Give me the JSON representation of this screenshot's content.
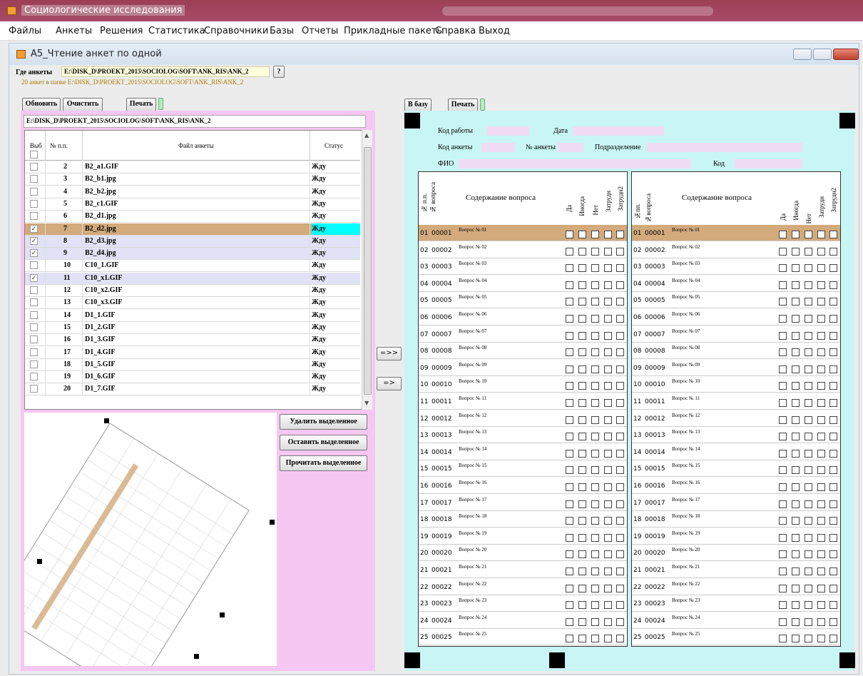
{
  "app_title": "Социологические исследования",
  "menu": [
    "Файлы",
    "Анкеты",
    "Решения",
    "Статистика",
    "Справочники",
    "Базы",
    "Отчеты",
    "Прикладные пакеты",
    "Справка",
    "Выход"
  ],
  "window_title": "А5_Чтение анкет по одной",
  "where_label": "Где анкеты",
  "where_value": "E:\\DISK_D\\PROEKT_2015\\SOCIOLOG\\SOFT\\ANK_RIS\\ANK_2",
  "browse_label": "?",
  "folder_status": "20 анкет в папке E:\\DISK_D\\PROEKT_2015\\SOCIOLOG\\SOFT\\ANK_RIS\\ANK_2",
  "btn_refresh": "Обновить",
  "btn_clear": "Очистить",
  "btn_print_left": "Печать",
  "btn_to_db": "В базу",
  "btn_print_right": "Печать",
  "path_display": "E:\\DISK_D\\PROEKT_2015\\SOCIOLOG\\SOFT\\ANK_RIS\\ANK_2",
  "grid": {
    "col_select": "Выб",
    "col_num": "№ п.п.",
    "col_file": "Файл анкеты",
    "col_status": "Статус",
    "rows": [
      {
        "n": "2",
        "f": "B2_a1.GIF",
        "s": "Жду",
        "chk": false,
        "sel": false,
        "cur": false
      },
      {
        "n": "3",
        "f": "B2_b1.jpg",
        "s": "Жду",
        "chk": false,
        "sel": false,
        "cur": false
      },
      {
        "n": "4",
        "f": "B2_b2.jpg",
        "s": "Жду",
        "chk": false,
        "sel": false,
        "cur": false
      },
      {
        "n": "5",
        "f": "B2_c1.GIF",
        "s": "Жду",
        "chk": false,
        "sel": false,
        "cur": false
      },
      {
        "n": "6",
        "f": "B2_d1.jpg",
        "s": "Жду",
        "chk": false,
        "sel": false,
        "cur": false
      },
      {
        "n": "7",
        "f": "B2_d2.jpg",
        "s": "Жду",
        "chk": true,
        "sel": true,
        "cur": true
      },
      {
        "n": "8",
        "f": "B2_d3.jpg",
        "s": "Жду",
        "chk": true,
        "sel": true,
        "cur": false
      },
      {
        "n": "9",
        "f": "B2_d4.jpg",
        "s": "Жду",
        "chk": true,
        "sel": true,
        "cur": false
      },
      {
        "n": "10",
        "f": "C10_1.GIF",
        "s": "Жду",
        "chk": false,
        "sel": false,
        "cur": false
      },
      {
        "n": "11",
        "f": "C10_x1.GIF",
        "s": "Жду",
        "chk": true,
        "sel": true,
        "cur": false
      },
      {
        "n": "12",
        "f": "C10_x2.GIF",
        "s": "Жду",
        "chk": false,
        "sel": false,
        "cur": false
      },
      {
        "n": "13",
        "f": "C10_x3.GIF",
        "s": "Жду",
        "chk": false,
        "sel": false,
        "cur": false
      },
      {
        "n": "14",
        "f": "D1_1.GIF",
        "s": "Жду",
        "chk": false,
        "sel": false,
        "cur": false
      },
      {
        "n": "15",
        "f": "D1_2.GIF",
        "s": "Жду",
        "chk": false,
        "sel": false,
        "cur": false
      },
      {
        "n": "16",
        "f": "D1_3.GIF",
        "s": "Жду",
        "chk": false,
        "sel": false,
        "cur": false
      },
      {
        "n": "17",
        "f": "D1_4.GIF",
        "s": "Жду",
        "chk": false,
        "sel": false,
        "cur": false
      },
      {
        "n": "18",
        "f": "D1_5.GIF",
        "s": "Жду",
        "chk": false,
        "sel": false,
        "cur": false
      },
      {
        "n": "19",
        "f": "D1_6.GIF",
        "s": "Жду",
        "chk": false,
        "sel": false,
        "cur": false
      },
      {
        "n": "20",
        "f": "D1_7.GIF",
        "s": "Жду",
        "chk": false,
        "sel": false,
        "cur": false
      }
    ]
  },
  "btn_delete_sel": "Удалить выделенное",
  "btn_keep_sel": "Оставить выделенное",
  "btn_read_sel": "Прочитать выделенное",
  "btn_move_all": "=>>",
  "btn_move_one": "=>",
  "form": {
    "work_code": "Код работы",
    "date": "Дата",
    "ank_code": "Код анкеты",
    "ank_num": "№ анкеты",
    "dept": "Подразделение",
    "fio": "ФИО",
    "code": "Код",
    "t1_np": "№ п.п.",
    "t1_nq": "№ вопроса",
    "t1_content": "Содержание вопроса",
    "t2_np": "№пп.",
    "t2_nq": "№вопроса",
    "t2_content": "Содержание вопроса",
    "answers": [
      "Да",
      "Иногда",
      "Нет",
      "Затрудн",
      "Затрудн2"
    ]
  },
  "questions": [
    {
      "n": "01",
      "c": "00001",
      "q": "Вопрос № 01"
    },
    {
      "n": "02",
      "c": "00002",
      "q": "Вопрос № 02"
    },
    {
      "n": "03",
      "c": "00003",
      "q": "Вопрос № 03"
    },
    {
      "n": "04",
      "c": "00004",
      "q": "Вопрос № 04"
    },
    {
      "n": "05",
      "c": "00005",
      "q": "Вопрос № 05"
    },
    {
      "n": "06",
      "c": "00006",
      "q": "Вопрос № 06"
    },
    {
      "n": "07",
      "c": "00007",
      "q": "Вопрос № 07"
    },
    {
      "n": "08",
      "c": "00008",
      "q": "Вопрос № 08"
    },
    {
      "n": "09",
      "c": "00009",
      "q": "Вопрос № 09"
    },
    {
      "n": "10",
      "c": "00010",
      "q": "Вопрос № 10"
    },
    {
      "n": "11",
      "c": "00011",
      "q": "Вопрос № 11"
    },
    {
      "n": "12",
      "c": "00012",
      "q": "Вопрос № 12"
    },
    {
      "n": "13",
      "c": "00013",
      "q": "Вопрос № 13"
    },
    {
      "n": "14",
      "c": "00014",
      "q": "Вопрос № 14"
    },
    {
      "n": "15",
      "c": "00015",
      "q": "Вопрос № 15"
    },
    {
      "n": "16",
      "c": "00016",
      "q": "Вопрос № 16"
    },
    {
      "n": "17",
      "c": "00017",
      "q": "Вопрос № 17"
    },
    {
      "n": "18",
      "c": "00018",
      "q": "Вопрос № 18"
    },
    {
      "n": "19",
      "c": "00019",
      "q": "Вопрос № 19"
    },
    {
      "n": "20",
      "c": "00020",
      "q": "Вопрос № 20"
    },
    {
      "n": "21",
      "c": "00021",
      "q": "Вопрос № 21"
    },
    {
      "n": "22",
      "c": "00022",
      "q": "Вопрос № 22"
    },
    {
      "n": "23",
      "c": "00023",
      "q": "Вопрос № 23"
    },
    {
      "n": "24",
      "c": "00024",
      "q": "Вопрос № 24"
    },
    {
      "n": "25",
      "c": "00025",
      "q": "Вопрос № 25"
    }
  ],
  "colors": {
    "selected_row": "#d2aa7c",
    "checked_row": "#e2e2f6",
    "current_cell": "#00ffff",
    "left_pane": "#f6c7f2",
    "right_pane": "#c8f6f4"
  }
}
